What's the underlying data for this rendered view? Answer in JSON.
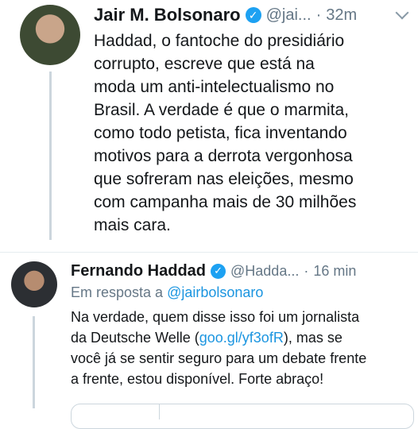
{
  "tweets": [
    {
      "name": "Jair M. Bolsonaro",
      "handle": "@jai...",
      "separator": "·",
      "time": "32m",
      "verified_icon": "verified-badge-icon",
      "lines": [
        "Haddad, o fantoche do presidiário",
        "corrupto, escreve que está na",
        "moda um anti-intelectualismo no",
        "Brasil. A verdade é que o marmita,",
        "como todo petista, fica inventando",
        "motivos para a derrota vergonhosa",
        "que sofreram nas eleições, mesmo",
        "com campanha mais de 30 milhões",
        "mais cara."
      ]
    },
    {
      "name": "Fernando Haddad",
      "handle": "@Hadda...",
      "separator": "·",
      "time": "16 min",
      "verified_icon": "verified-badge-icon",
      "reply_prefix": "Em resposta a",
      "reply_mention": "@jairbolsonaro",
      "line1": "Na verdade, quem disse isso foi um jornalista",
      "line2_pre": "da Deutsche Welle (",
      "line2_link": "goo.gl/yf3ofR",
      "line2_post": "), mas se",
      "line3": "você já se sentir seguro para um debate frente",
      "line4": "a frente, estou disponível. Forte abraço!"
    }
  ],
  "colors": {
    "accent": "#1b95e0",
    "verified": "#1da1f2",
    "secondary_text": "#657786",
    "divider": "#e6ecf0"
  }
}
